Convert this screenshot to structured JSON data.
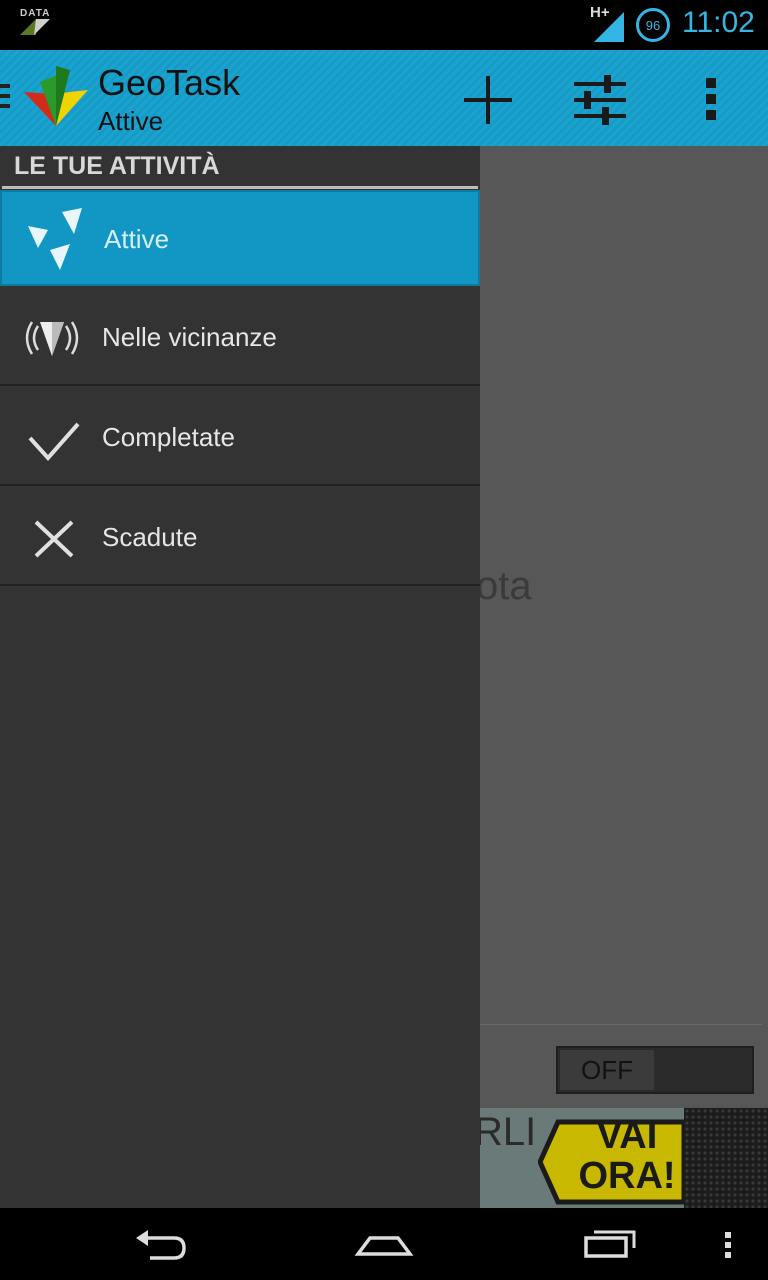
{
  "status_bar": {
    "data_label": "DATA",
    "network": "H+",
    "battery": "96",
    "time": "11:02",
    "accent": "#33b5e5"
  },
  "action_bar": {
    "app_title": "GeoTask",
    "subtitle": "Attive",
    "icons": [
      "drawer-indicator-icon",
      "geotask-logo-icon",
      "add-icon",
      "sliders-icon",
      "overflow-menu-icon"
    ],
    "color": "#1aa3cf"
  },
  "drawer": {
    "header": "LE TUE ATTIVITÀ",
    "items": [
      {
        "label": "Attive",
        "icon": "active-arrows-icon",
        "selected": true
      },
      {
        "label": "Nelle vicinanze",
        "icon": "nearby-signal-icon",
        "selected": false
      },
      {
        "label": "Completate",
        "icon": "checkmark-icon",
        "selected": false
      },
      {
        "label": "Scadute",
        "icon": "close-x-icon",
        "selected": false
      }
    ]
  },
  "background": {
    "empty_text_fragment": "ota",
    "toggle_label": "OFF",
    "ad": {
      "left_text": "RLI",
      "badge_text": "VAI ORA!"
    }
  },
  "nav_bar": {
    "icons": [
      "back-icon",
      "home-icon",
      "recent-apps-icon",
      "menu-icon"
    ]
  }
}
